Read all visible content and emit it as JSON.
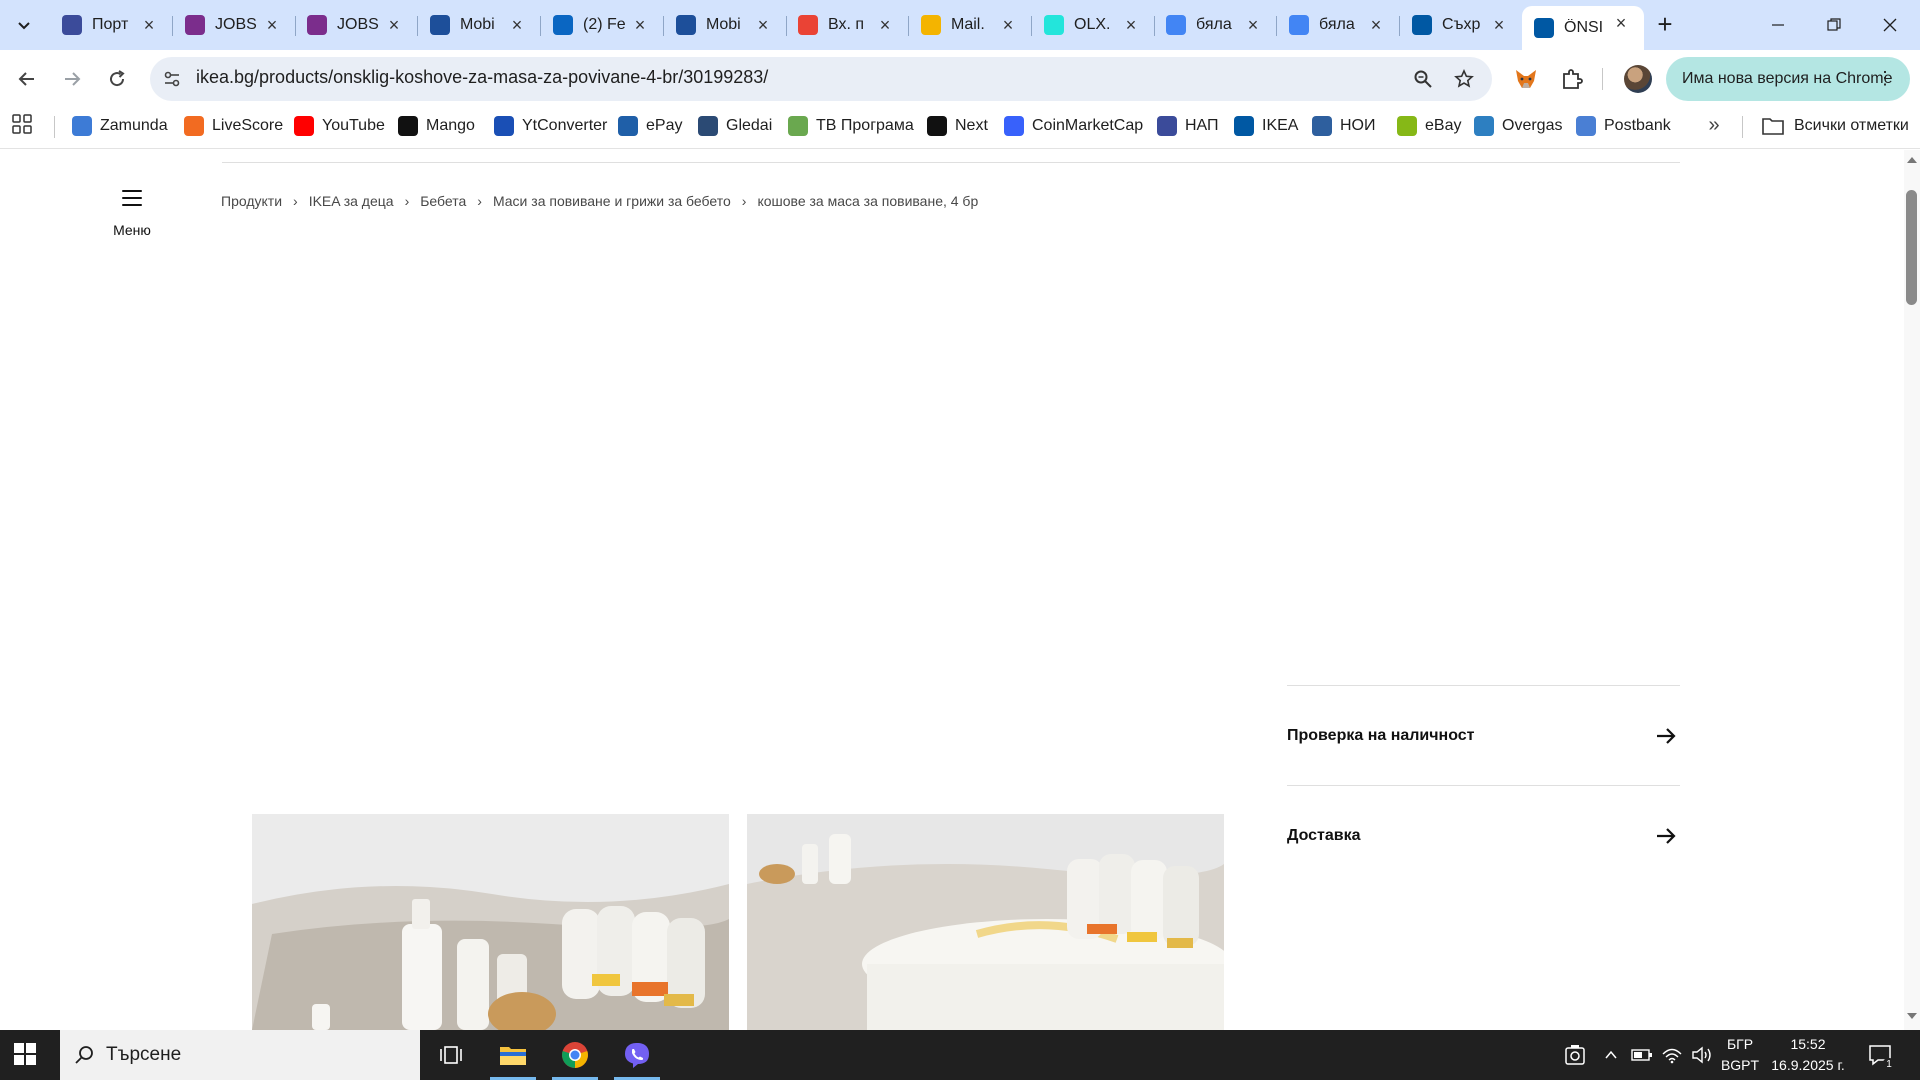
{
  "browser": {
    "tabs": [
      {
        "label": "Порт",
        "icon": "nap-icon",
        "color": "#3b4b9a"
      },
      {
        "label": "JOBS.",
        "icon": "jobs-icon",
        "color": "#7b2d8c"
      },
      {
        "label": "JOBS.",
        "icon": "jobs-icon",
        "color": "#7b2d8c"
      },
      {
        "label": "Mobi",
        "icon": "mobile-icon",
        "color": "#1d4f9a"
      },
      {
        "label": "(2) Fe",
        "icon": "linkedin-icon",
        "color": "#0a66c2"
      },
      {
        "label": "Mobi",
        "icon": "mobile-icon",
        "color": "#1d4f9a"
      },
      {
        "label": "Вх. п",
        "icon": "gmail-icon",
        "color": "#ea4335"
      },
      {
        "label": "Mail.",
        "icon": "mailbg-icon",
        "color": "#f4b400"
      },
      {
        "label": "OLX.",
        "icon": "olx-icon",
        "color": "#23e5db"
      },
      {
        "label": "бяла",
        "icon": "google-icon",
        "color": "#4285f4"
      },
      {
        "label": "бяла",
        "icon": "google-icon",
        "color": "#4285f4"
      },
      {
        "label": "Съхр",
        "icon": "ikea-icon",
        "color": "#0058a3"
      },
      {
        "label": "ÖNSI",
        "icon": "ikea-icon",
        "color": "#0058a3",
        "active": true
      }
    ],
    "url": {
      "host": "ikea.bg",
      "path": "/products/onsklig-koshove-za-masa-za-povivane-4-br/30199283/"
    },
    "update_button": "Има нова версия на Chrome",
    "bookmarks": [
      {
        "label": "Zamunda",
        "icon": "zamunda-icon",
        "color": "#3d7bd6"
      },
      {
        "label": "LiveScore",
        "icon": "livescore-icon",
        "color": "#f26b21"
      },
      {
        "label": "YouTube",
        "icon": "youtube-icon",
        "color": "#ff0000"
      },
      {
        "label": "Mango",
        "icon": "mango-icon",
        "color": "#111111"
      },
      {
        "label": "YtConverter",
        "icon": "ytconverter-icon",
        "color": "#1a4fb5"
      },
      {
        "label": "ePay",
        "icon": "epay-icon",
        "color": "#1f5fa8"
      },
      {
        "label": "Gledai",
        "icon": "tv-icon",
        "color": "#2b4a74"
      },
      {
        "label": "ТВ Програма",
        "icon": "tv-program-icon",
        "color": "#6aa84f"
      },
      {
        "label": "Next",
        "icon": "next-icon",
        "color": "#111111"
      },
      {
        "label": "CoinMarketCap",
        "icon": "coinmarketcap-icon",
        "color": "#3861fb"
      },
      {
        "label": "НАП",
        "icon": "nap-icon",
        "color": "#3b4b9a"
      },
      {
        "label": "IKEA",
        "icon": "ikea-icon",
        "color": "#0058a3"
      },
      {
        "label": "НОИ",
        "icon": "noi-icon",
        "color": "#2e5f9e"
      },
      {
        "label": "eBay",
        "icon": "ebay-icon",
        "color": "#86b817"
      },
      {
        "label": "Overgas",
        "icon": "overgas-icon",
        "color": "#2d7fc1"
      },
      {
        "label": "Postbank",
        "icon": "postbank-icon",
        "color": "#4a7fd4"
      }
    ],
    "all_bookmarks": "Всички отметки"
  },
  "page": {
    "menu_label": "Меню",
    "breadcrumb": [
      "Продукти",
      "IKEA за деца",
      "Бебета",
      "Маси за повиване и грижи за бебето",
      "кошове за маса за повиване, 4 бр"
    ],
    "side_links": [
      "Проверка на наличност",
      "Доставка"
    ]
  },
  "taskbar": {
    "search_placeholder": "Търсене",
    "language": "БГР",
    "layout": "BGPT",
    "time": "15:52",
    "date": "16.9.2025 г.",
    "notifications": "1"
  },
  "colors": {
    "tabstrip": "#d3e3fd",
    "omnibox": "#e9eef6",
    "update_button": "#b4e6e3",
    "taskbar": "#202020"
  }
}
